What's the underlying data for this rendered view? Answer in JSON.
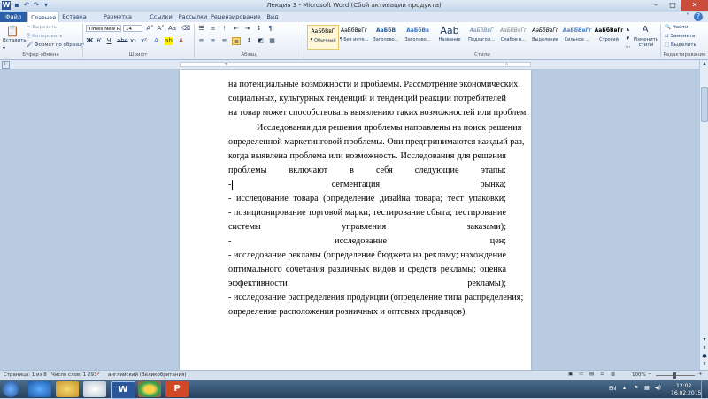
{
  "title_bar": {
    "title": "Лекция 3  -  Microsoft Word (Сбой активации продукта)",
    "minimize": "–",
    "maximize": "□",
    "close": "✕"
  },
  "tabs": [
    "Файл",
    "Главная",
    "Вставка",
    "Разметка страницы",
    "Ссылки",
    "Рассылки",
    "Рецензирование",
    "Вид"
  ],
  "ribbon": {
    "clipboard": {
      "paste": "Вставить",
      "cut": "Вырезать",
      "copy": "Копировать",
      "format_painter": "Формат по образцу",
      "group_label": "Буфер обмена"
    },
    "font": {
      "name": "Times New Ro",
      "size": "14",
      "group_label": "Шрифт"
    },
    "paragraph": {
      "group_label": "Абзац"
    },
    "styles": {
      "items": [
        {
          "preview": "АаБбВвГ",
          "name": "¶ Обычный"
        },
        {
          "preview": "АаБбВвГг",
          "name": "¶ Без инте..."
        },
        {
          "preview": "АаБбВ",
          "name": "Заголово..."
        },
        {
          "preview": "АаБбВв",
          "name": "Заголово..."
        },
        {
          "preview": "Aab",
          "name": "Название"
        },
        {
          "preview": "АаБбВвГ",
          "name": "Подзагол..."
        },
        {
          "preview": "АаБбВеГг",
          "name": "Слабое в..."
        },
        {
          "preview": "АаБбВвГг",
          "name": "Выделение"
        },
        {
          "preview": "АаБбВвГг",
          "name": "Сильное ..."
        },
        {
          "preview": "АаБбВвГг",
          "name": "Строгий"
        }
      ],
      "change_styles": "Изменить стили",
      "group_label": "Стили"
    },
    "editing": {
      "find": "Найти",
      "replace": "Заменить",
      "select": "Выделить",
      "group_label": "Редактирование"
    }
  },
  "document": {
    "lines": [
      "на потенциальные возможности и проблемы. Рассмотрение экономических,",
      "социальных, культурных тенденций и тенденций реакции потребителей",
      "на товар может способствовать выявлению таких возможностей или проблем.",
      "Исследования для решения проблемы направлены на поиск решения",
      "определенной маркетинговой проблемы. Они предпринимаются каждый раз,",
      "когда выявлена проблема или возможность. Исследования для решения",
      "проблемы включают в себя следующие этапы:",
      "- сегментация рынка;",
      "- исследование товара (определение дизайна товара; тест упаковки;",
      "- позиционирование торговой марки; тестирование сбыта; тестирование",
      "системы управления заказами);",
      "- исследование цен;",
      "- исследование рекламы (определение бюджета на рекламу; нахождение",
      "оптимального сочетания различных видов и средств рекламы; оценка",
      "эффективности рекламы);",
      "- исследование распределения продукции (определение типа распределения;",
      "определение расположения розничных и оптовых продавцов)."
    ]
  },
  "status_bar": {
    "page": "Страница: 1 из 8",
    "words": "Число слов: 1 293",
    "language": "английский (Великобритания)",
    "zoom": "100%"
  },
  "taskbar": {
    "language": "EN",
    "time": "12:02",
    "date": "16.02.2015"
  }
}
